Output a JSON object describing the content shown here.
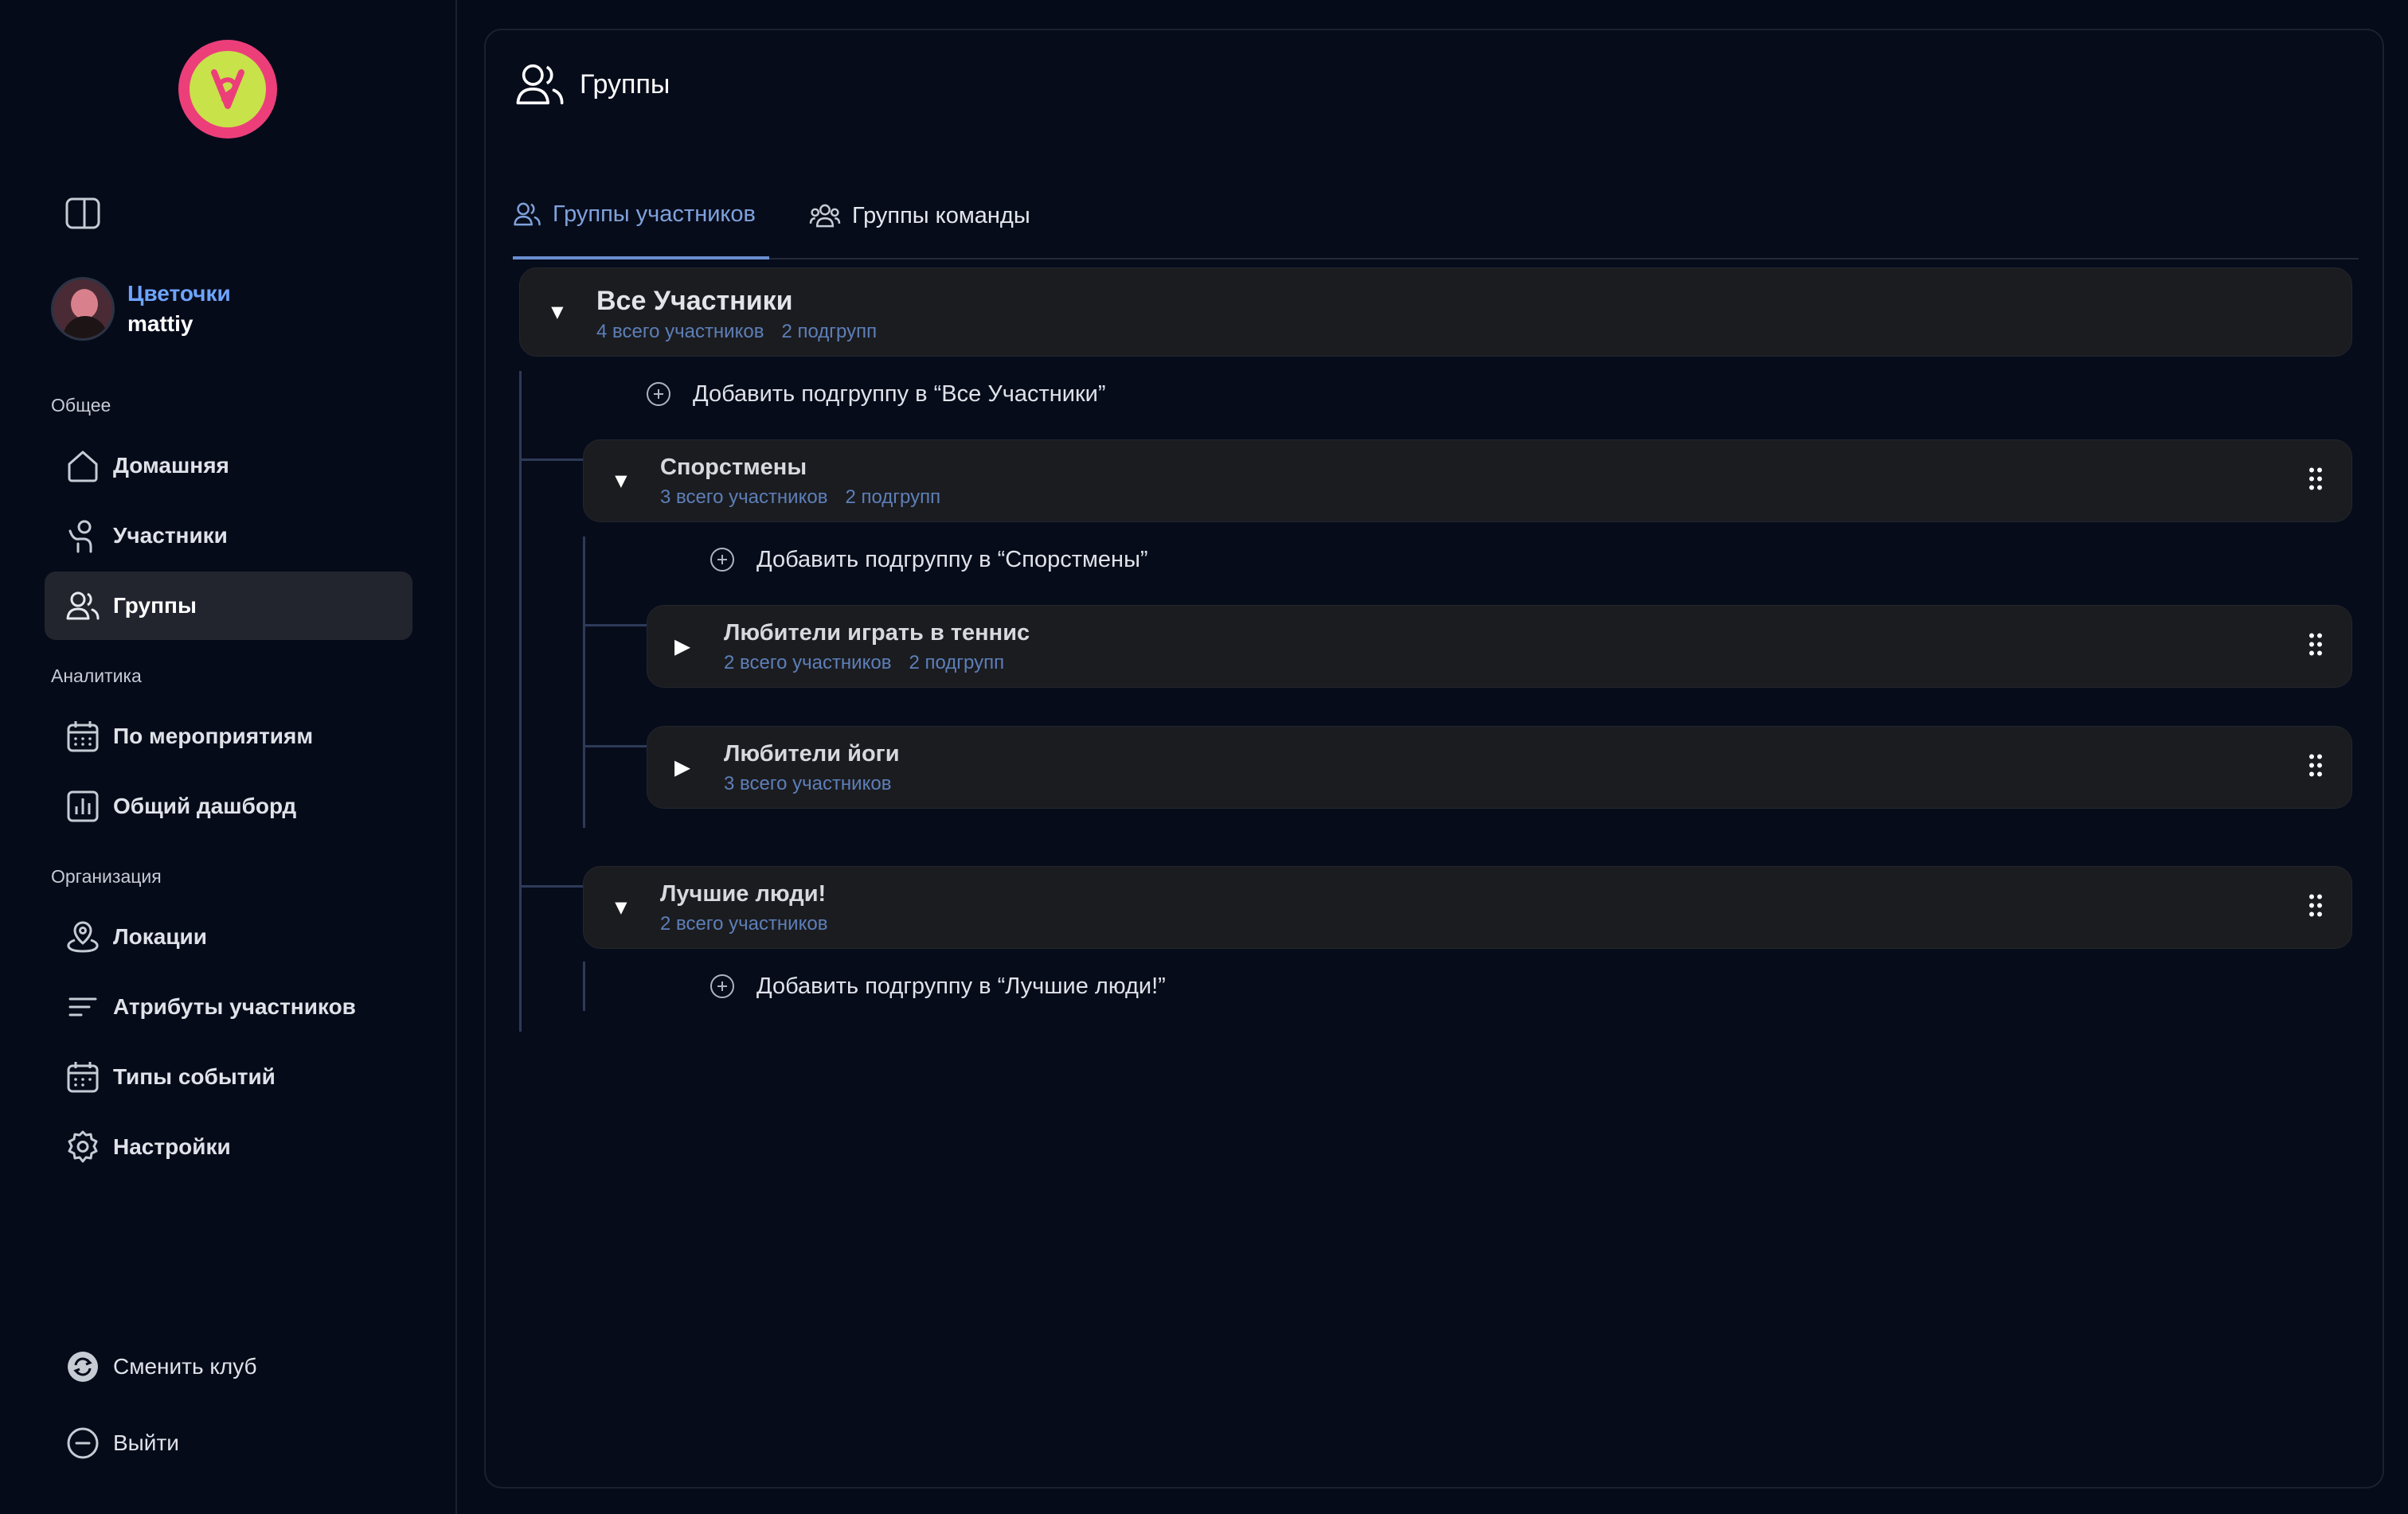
{
  "sidebar": {
    "profile": {
      "club": "Цветочки",
      "user": "mattiy"
    },
    "sections": [
      {
        "label": "Общее",
        "items": [
          {
            "label": "Домашняя",
            "icon": "home-icon"
          },
          {
            "label": "Участники",
            "icon": "participant-icon"
          },
          {
            "label": "Группы",
            "icon": "groups-icon",
            "active": true
          }
        ]
      },
      {
        "label": "Аналитика",
        "items": [
          {
            "label": "По мероприятиям",
            "icon": "calendar-icon"
          },
          {
            "label": "Общий дашборд",
            "icon": "bar-chart-icon"
          }
        ]
      },
      {
        "label": "Организация",
        "items": [
          {
            "label": "Локации",
            "icon": "location-icon"
          },
          {
            "label": "Атрибуты участников",
            "icon": "attributes-icon"
          },
          {
            "label": "Типы событий",
            "icon": "event-types-icon"
          },
          {
            "label": "Настройки",
            "icon": "gear-icon"
          }
        ]
      }
    ],
    "bottom": [
      {
        "label": "Сменить клуб",
        "icon": "switch-club-icon"
      },
      {
        "label": "Выйти",
        "icon": "logout-icon"
      }
    ]
  },
  "page": {
    "title": "Группы",
    "tabs": [
      {
        "label": "Группы участников",
        "active": true
      },
      {
        "label": "Группы команды",
        "active": false
      }
    ]
  },
  "tree": {
    "root": {
      "title": "Все Участники",
      "members": "4 всего участников",
      "subgroups": "2 подгрупп",
      "add_label": "Добавить подгруппу в “Все Участники”"
    },
    "groups": [
      {
        "title": "Спорстмены",
        "members": "3 всего участников",
        "subgroups": "2 подгрупп",
        "add_label": "Добавить подгруппу в “Спорстмены”",
        "children": [
          {
            "title": "Любители играть в теннис",
            "members": "2 всего участников",
            "subgroups": "2 подгрупп"
          },
          {
            "title": "Любители йоги",
            "members": "3 всего участников",
            "subgroups": ""
          }
        ]
      },
      {
        "title": "Лучшие люди!",
        "members": "2 всего участников",
        "subgroups": "",
        "add_label": "Добавить подгруппу в “Лучшие люди!”"
      }
    ]
  }
}
